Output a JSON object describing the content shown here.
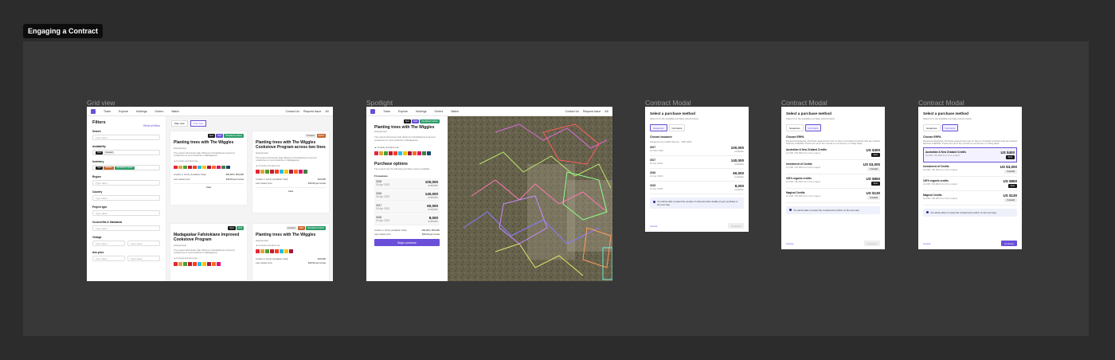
{
  "page_title": "Engaging a Contract",
  "frames": {
    "grid": "Grid view",
    "spotlight": "Spotlight",
    "modal1": "Contract Modal",
    "modal2": "Contract Modal",
    "modal3": "Contract Modal"
  },
  "nav": {
    "items": [
      "Trade",
      "Explore",
      "Holdings",
      "Orders",
      "Watch"
    ],
    "contact": "Contact Us",
    "request": "Request Issue",
    "user": "AS"
  },
  "grid": {
    "filters_title": "Filters",
    "reset": "Reset all filters",
    "labels": [
      "Search",
      "Availability",
      "Inventory",
      "Region",
      "Country",
      "Project type",
      "Co-benefits & Standards",
      "Vintage",
      "Ask price"
    ],
    "placeholder": "Type value",
    "chips_availability": [
      "Spot",
      "Forward"
    ],
    "chips_inventory": [
      "Spot",
      "REDD+",
      "Woodland Carbon"
    ],
    "view_map": "Map view",
    "view_grid": "Grid view",
    "cards": [
      {
        "title": "Planting trees with The Wiggles",
        "sub": "Anonymous",
        "desc": "The project will donate high efficiency Fofofeldamas improved cookstoves to rural residents in Madagascar.",
        "tags": [
          "Spot",
          "NWI",
          "Woodland Carbon"
        ],
        "cobenefit": "Forestry and land use",
        "k1": "Credits or Verify (Available Total)",
        "v1": "200,000 / 200,000",
        "k2": "Last traded price",
        "v2": "$40.00 per tonne",
        "cta": "View"
      },
      {
        "title": "Planting trees with The Wiggles Cookstove Program across two lines",
        "sub": "Anonymous",
        "desc": "The project will donate high efficiency Fofofeldamas improved cookstoves to rural residents in Madagascar.",
        "tags": [
          "Forward",
          "REDD"
        ],
        "cobenefit": "Forestry and land use",
        "k1": "Credits or Verify (Available Total)",
        "v1": "$10,000",
        "k2": "Last traded price",
        "v2": "$40.00 per tonne",
        "cta": "View"
      },
      {
        "title": "Madagaskar Fafotokiane Improved Cookstove Program",
        "sub": "Anonymous",
        "desc": "The project will donate high efficiency Fofofeldamas improved cookstoves to rural residents in Madagascar.",
        "tags": [
          "Spot",
          "VCS"
        ],
        "cobenefit": "Forests and land use",
        "k1": "",
        "v1": "",
        "k2": "",
        "v2": "",
        "cta": ""
      },
      {
        "title": "Planting trees with The Wiggles",
        "sub": "Anonymous",
        "desc": "",
        "tags": [
          "Forward",
          "ARR",
          "Woodland Carbon"
        ],
        "cobenefit": "Forestry and land use",
        "k1": "Credits or Verify (Available Total)",
        "v1": "$10,000",
        "k2": "Last traded price",
        "v2": "$40.00 per tonne",
        "cta": ""
      }
    ]
  },
  "spotlight": {
    "title": "Planting trees with The Wiggles",
    "sub": "Anonymous",
    "desc": "The project will donate high efficiency Fofofeldamas improved cookstoves to rural residents in Madagascar.",
    "tags": [
      "Spot",
      "NWI",
      "Woodland Carbon"
    ],
    "cobenefit": "Forestry and land use",
    "options_title": "Purchase options",
    "options_sub": "The project has the following purchase options available",
    "group": "Issuances",
    "rows": [
      {
        "year": "2015",
        "date": "30 Apr 2022",
        "qty": "100,000",
        "unit": "available"
      },
      {
        "year": "2016",
        "date": "30 Apr 2022",
        "qty": "140,000",
        "unit": "available"
      },
      {
        "year": "2017",
        "date": "30 Apr 2022",
        "qty": "60,000",
        "unit": "available"
      },
      {
        "year": "2018",
        "date": "30 Apr 2022",
        "qty": "8,000",
        "unit": "available"
      }
    ],
    "k1": "Credits or Verify (Available Total)",
    "v1": "200,000 / 200,000",
    "k2": "Last traded price",
    "v2": "$40.00 per tonne",
    "cta": "Begin purchase"
  },
  "modal1": {
    "title": "Select a purchase method",
    "sub": "Select from the available purchase options below.",
    "tabs": [
      "Issuances",
      "Contracts"
    ],
    "group": "Choose Issuance",
    "group_sub": "Issuances are credits that are... 20th 2023",
    "rows": [
      {
        "year": "2017",
        "date": "22 Mar 2023",
        "qty": "100,000",
        "unit": "available"
      },
      {
        "year": "2017",
        "date": "26 Apr 2023",
        "qty": "140,000",
        "unit": "available"
      },
      {
        "year": "2016",
        "date": "14 Apr 2023",
        "qty": "60,000",
        "unit": "available"
      },
      {
        "year": "2015",
        "date": "14 Apr 2023",
        "qty": "8,000",
        "unit": "available"
      }
    ],
    "info": "You will be able to select the number of units and other details of your purchase in the next step.",
    "cancel": "Cancel",
    "continue": "Continue"
  },
  "modal2": {
    "title": "Select a purchase method",
    "sub": "Select from the available purchase options below.",
    "tabs": [
      "Issuances",
      "Contracts"
    ],
    "group": "Choose ERPA",
    "group_sub": "Emissions Reduction Purchase Agreements refer to Spot or Forward Contracts that are verified batches of ERPAs. Prices are set in the contract on an ad-hoc or rolling basis.",
    "rows": [
      {
        "name": "Australian & New Zealand Credits",
        "meta": "10,000 / 80,000 from this project",
        "price": "US $400",
        "kind": "Spot"
      },
      {
        "name": "Investment of Credits",
        "meta": "10,000 / 80,000 from this project",
        "price": "US $3,000",
        "kind": "Forward"
      },
      {
        "name": "100% organic credits",
        "meta": "10,000 / 80,000 from this project",
        "price": "US $850",
        "kind": "Spot"
      },
      {
        "name": "Magical Credits",
        "meta": "10,000 / 80,000 from this project",
        "price": "US $130",
        "kind": "Forward"
      }
    ],
    "info": "You will be able to review the contract and confirm on the next step.",
    "cancel": "Cancel",
    "continue": "Continue"
  },
  "modal3": {
    "title": "Select a purchase method",
    "sub": "Select from the available purchase options below.",
    "tabs": [
      "Issuances",
      "Contracts"
    ],
    "group": "Choose ERPA",
    "group_sub": "Emissions Reduction Purchase Agreements refer to Spot or Forward Contracts that are verified batches of ERPAs. Prices are set in the contract on an ad-hoc or rolling basis.",
    "rows": [
      {
        "name": "Australian & New Zealand Credits",
        "meta": "10,000 / 80,000 from this project",
        "price": "US $400",
        "kind": "Spot"
      },
      {
        "name": "Investment of Credits",
        "meta": "10,000 / 80,000 from this project",
        "price": "US $3,000",
        "kind": "Forward"
      },
      {
        "name": "100% organic credits",
        "meta": "10,000 / 80,000 from this project",
        "price": "US $850",
        "kind": "Spot"
      },
      {
        "name": "Magical Credits",
        "meta": "10,000 / 80,000 from this project",
        "price": "US $130",
        "kind": "Forward"
      }
    ],
    "info": "You will be able to review the contract and confirm on the next step.",
    "cancel": "Cancel",
    "continue": "Continue"
  },
  "colors": {
    "accent": "#6b4fd8",
    "spot": "#1a1a1a",
    "forward": "#f0f0f0",
    "green": "#2e9d6a",
    "orange": "#c5642a"
  }
}
